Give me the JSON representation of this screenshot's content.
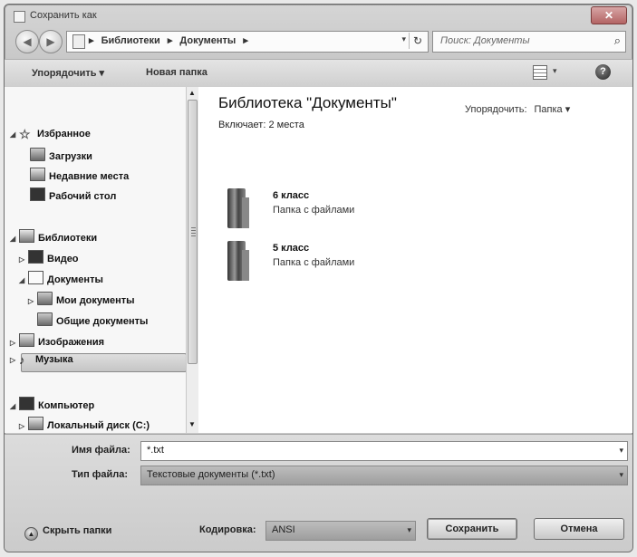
{
  "window": {
    "title": "Сохранить как",
    "close": "✕"
  },
  "nav": {
    "back": "◀",
    "forward": "▶",
    "crumbs": [
      "Библиотеки",
      "Документы"
    ],
    "sep": "▸",
    "dropdown": "▾",
    "refresh": "↻"
  },
  "search": {
    "placeholder": "Поиск: Документы",
    "icon": "⌕"
  },
  "toolbar": {
    "organize": "Упорядочить ▾",
    "new_folder": "Новая папка",
    "view_dd": "▾",
    "help": "?"
  },
  "sidebar": {
    "favorites": "Избранное",
    "downloads": "Загрузки",
    "recent": "Недавние места",
    "desktop": "Рабочий стол",
    "libraries": "Библиотеки",
    "video": "Видео",
    "documents": "Документы",
    "my_documents": "Мои документы",
    "shared_documents": "Общие документы",
    "images": "Изображения",
    "music": "Музыка",
    "computer": "Компьютер",
    "local_disk": "Локальный диск (C:)"
  },
  "content": {
    "title": "Библиотека \"Документы\"",
    "subtitle": "Включает: 2 места",
    "arrange_label": "Упорядочить:",
    "arrange_value": "Папка ▾",
    "folders": [
      {
        "name": "6 класс",
        "type": "Папка с файлами"
      },
      {
        "name": "5 класс",
        "type": "Папка с файлами"
      }
    ]
  },
  "bottom": {
    "filename_label": "Имя файла:",
    "filename_value": "*.txt",
    "filetype_label": "Тип файла:",
    "filetype_value": "Текстовые документы (*.txt)",
    "hide_folders": "Скрыть папки",
    "encoding_label": "Кодировка:",
    "encoding_value": "ANSI",
    "save": "Сохранить",
    "cancel": "Отмена"
  }
}
